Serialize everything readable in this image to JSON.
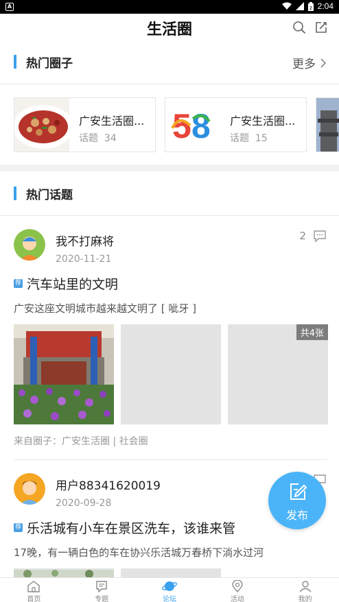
{
  "status_bar": {
    "time": "2:04",
    "app_badge": "A"
  },
  "header": {
    "title": "生活圈"
  },
  "hot_circles": {
    "heading": "热门圈子",
    "more_label": "更多",
    "items": [
      {
        "name": "广安生活圈...",
        "topics_label": "话题",
        "topics_count": "34",
        "thumb_icon": "food-photo"
      },
      {
        "name": "广安生活圈...",
        "topics_label": "话题",
        "topics_count": "15",
        "thumb_icon": "58-logo",
        "logo_text": "58"
      },
      {
        "name": "",
        "thumb_icon": "pagoda-photo"
      }
    ]
  },
  "hot_topics": {
    "heading": "热门话题",
    "posts": [
      {
        "user": "我不打麻将",
        "date": "2020-11-21",
        "comment_count": "2",
        "tag": "荐",
        "title": "汽车站里的文明",
        "text": "广安这座文明城市越来越文明了 [ 呲牙 ]",
        "image_count_label": "共4张",
        "from_label": "来自圈子：广安生活圈 | 社会圈"
      },
      {
        "user": "用户88341620019",
        "date": "2020-09-28",
        "comment_count": "",
        "tag": "荐",
        "title": "乐活城有小车在景区洗车，该谁来管",
        "text": "17晚，有一辆白色的车在协兴乐活城万春桥下淌水过河"
      }
    ]
  },
  "fab": {
    "label": "发布"
  },
  "tabs": [
    {
      "label": "首页",
      "icon": "home-icon",
      "active": false
    },
    {
      "label": "专题",
      "icon": "topic-icon",
      "active": false
    },
    {
      "label": "论坛",
      "icon": "forum-planet-icon",
      "active": true
    },
    {
      "label": "活动",
      "icon": "location-icon",
      "active": false
    },
    {
      "label": "我的",
      "icon": "profile-icon",
      "active": false
    }
  ],
  "colors": {
    "accent": "#3aa1ee",
    "fab": "#4bb4f8"
  }
}
